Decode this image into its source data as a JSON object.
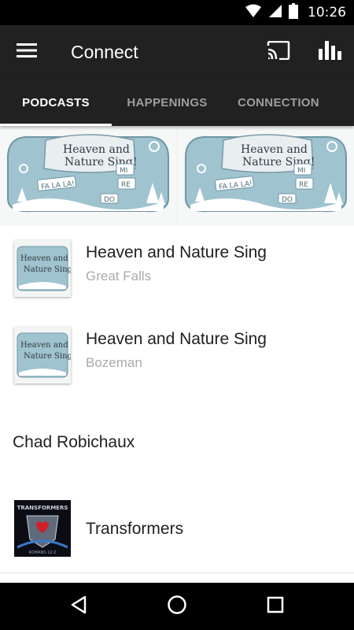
{
  "status_bar": {
    "time": "10:26",
    "icons": [
      "wifi-icon",
      "cellular-signal-icon",
      "battery-icon"
    ]
  },
  "app_bar": {
    "title": "Connect",
    "icons": [
      "menu-icon",
      "cast-icon",
      "bar-chart-icon"
    ]
  },
  "tabs": [
    {
      "label": "PODCASTS",
      "active": true
    },
    {
      "label": "HAPPENINGS",
      "active": false
    },
    {
      "label": "CONNECTION",
      "active": false
    }
  ],
  "hero": {
    "artwork_text": [
      "Heaven and",
      "Nature Sing!",
      "FA LA LA!",
      "MI",
      "RE",
      "DO"
    ]
  },
  "list": [
    {
      "title": "Heaven and Nature Sing",
      "subtitle": "Great Falls",
      "artwork_text": [
        "Heaven and",
        "Nature Sing!"
      ]
    },
    {
      "title": "Heaven and Nature Sing",
      "subtitle": "Bozeman",
      "artwork_text": [
        "Heaven and",
        "Nature Sing!"
      ]
    },
    {
      "title": "Chad Robichaux"
    },
    {
      "title": "Transformers",
      "artwork_text": [
        "TRANSFORMERS",
        "ROMANS 12:2"
      ]
    }
  ],
  "nav_bar": {
    "icons": [
      "back-icon",
      "home-icon",
      "recents-icon"
    ]
  },
  "colors": {
    "status_bar": "#000000",
    "app_bar": "#212121",
    "tab_active": "#ffffff",
    "tab_inactive": "#9e9e9e",
    "subtitle": "#aaaaaa",
    "artwork_blue": "#9fc3cf"
  }
}
